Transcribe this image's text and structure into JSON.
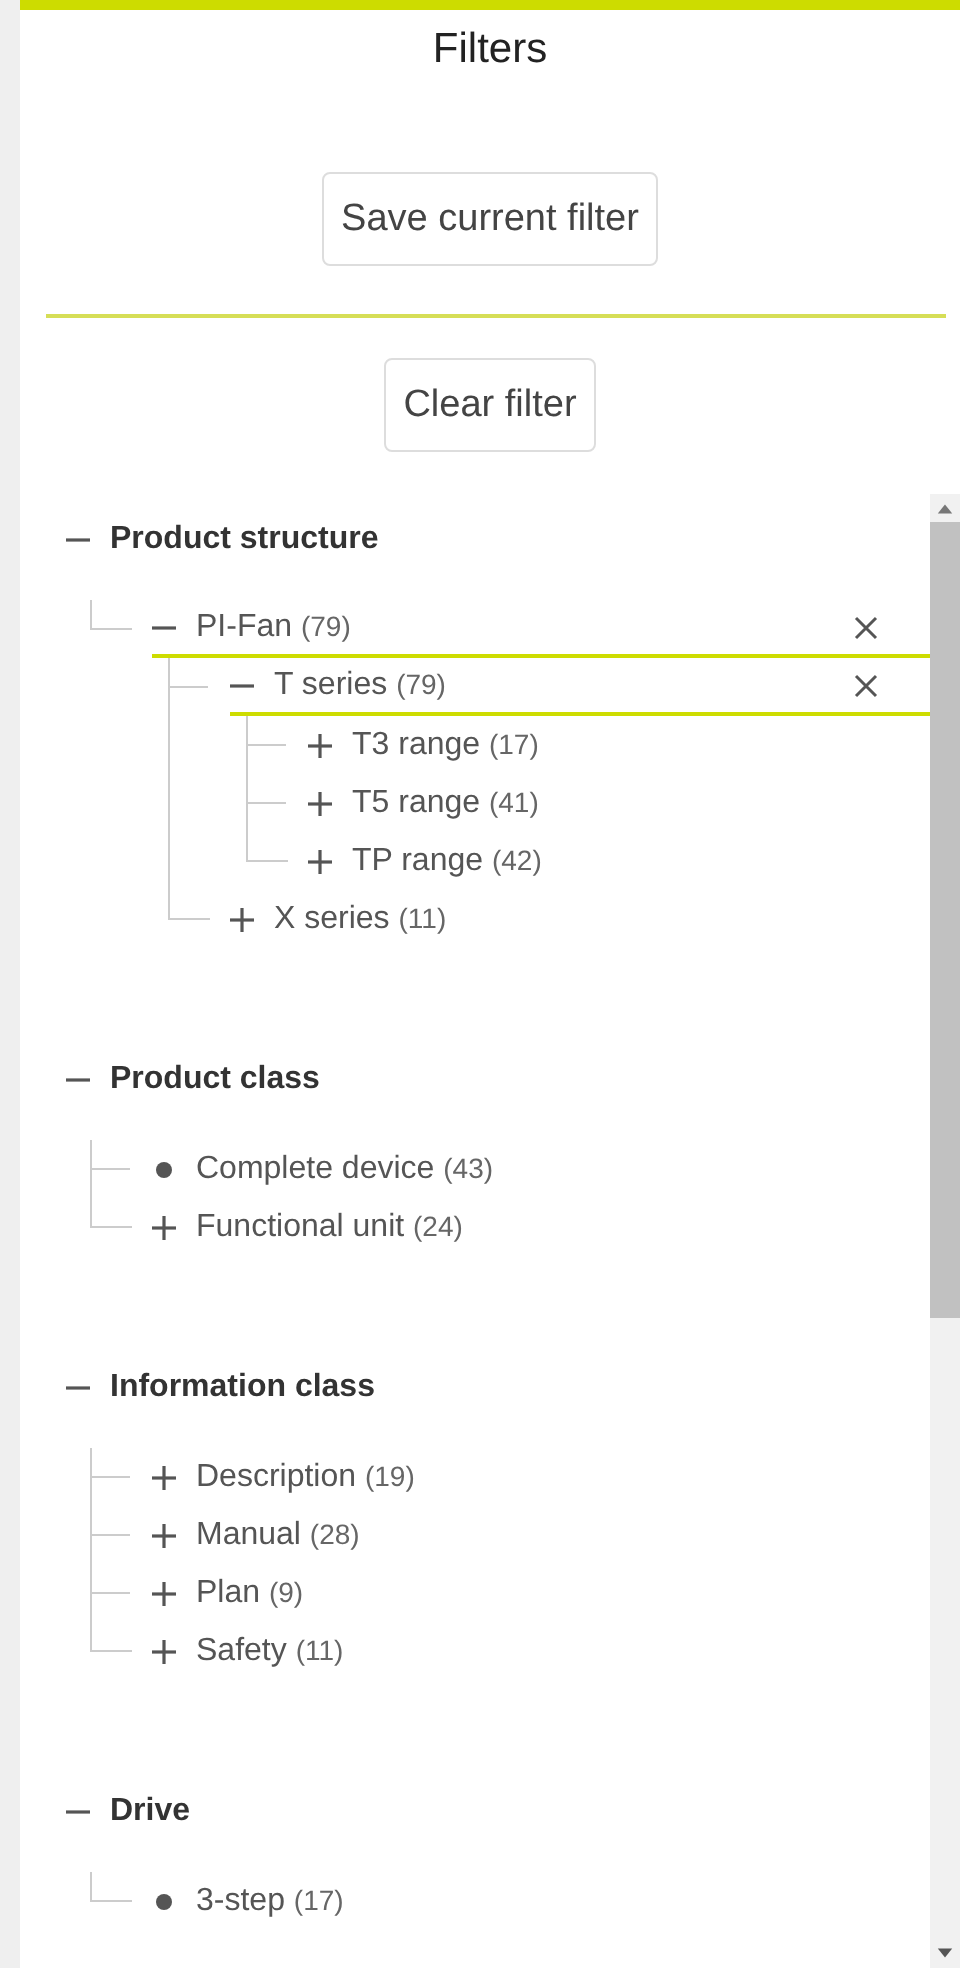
{
  "title": "Filters",
  "save_button": "Save current filter",
  "clear_button": "Clear filter",
  "sections": [
    {
      "label": "Product structure",
      "expanded": true,
      "children": [
        {
          "label": "PI-Fan",
          "count": "(79)",
          "kind": "branch",
          "expanded": true,
          "selected": true,
          "children": [
            {
              "label": "T series",
              "count": "(79)",
              "kind": "branch",
              "expanded": true,
              "selected": true,
              "children": [
                {
                  "label": "T3 range",
                  "count": "(17)",
                  "kind": "branch",
                  "expanded": false,
                  "selected": false
                },
                {
                  "label": "T5 range",
                  "count": "(41)",
                  "kind": "branch",
                  "expanded": false,
                  "selected": false
                },
                {
                  "label": "TP range",
                  "count": "(42)",
                  "kind": "branch",
                  "expanded": false,
                  "selected": false
                }
              ]
            },
            {
              "label": "X series",
              "count": "(11)",
              "kind": "branch",
              "expanded": false,
              "selected": false
            }
          ]
        }
      ]
    },
    {
      "label": "Product class",
      "expanded": true,
      "children": [
        {
          "label": "Complete device",
          "count": "(43)",
          "kind": "leaf",
          "selected": false
        },
        {
          "label": "Functional unit",
          "count": "(24)",
          "kind": "branch",
          "expanded": false,
          "selected": false
        }
      ]
    },
    {
      "label": "Information class",
      "expanded": true,
      "children": [
        {
          "label": "Description",
          "count": "(19)",
          "kind": "branch",
          "expanded": false,
          "selected": false
        },
        {
          "label": "Manual",
          "count": "(28)",
          "kind": "branch",
          "expanded": false,
          "selected": false
        },
        {
          "label": "Plan",
          "count": "(9)",
          "kind": "branch",
          "expanded": false,
          "selected": false
        },
        {
          "label": "Safety",
          "count": "(11)",
          "kind": "branch",
          "expanded": false,
          "selected": false
        }
      ]
    },
    {
      "label": "Drive",
      "expanded": true,
      "children": [
        {
          "label": "3-step",
          "count": "(17)",
          "kind": "leaf",
          "selected": false
        }
      ]
    }
  ]
}
